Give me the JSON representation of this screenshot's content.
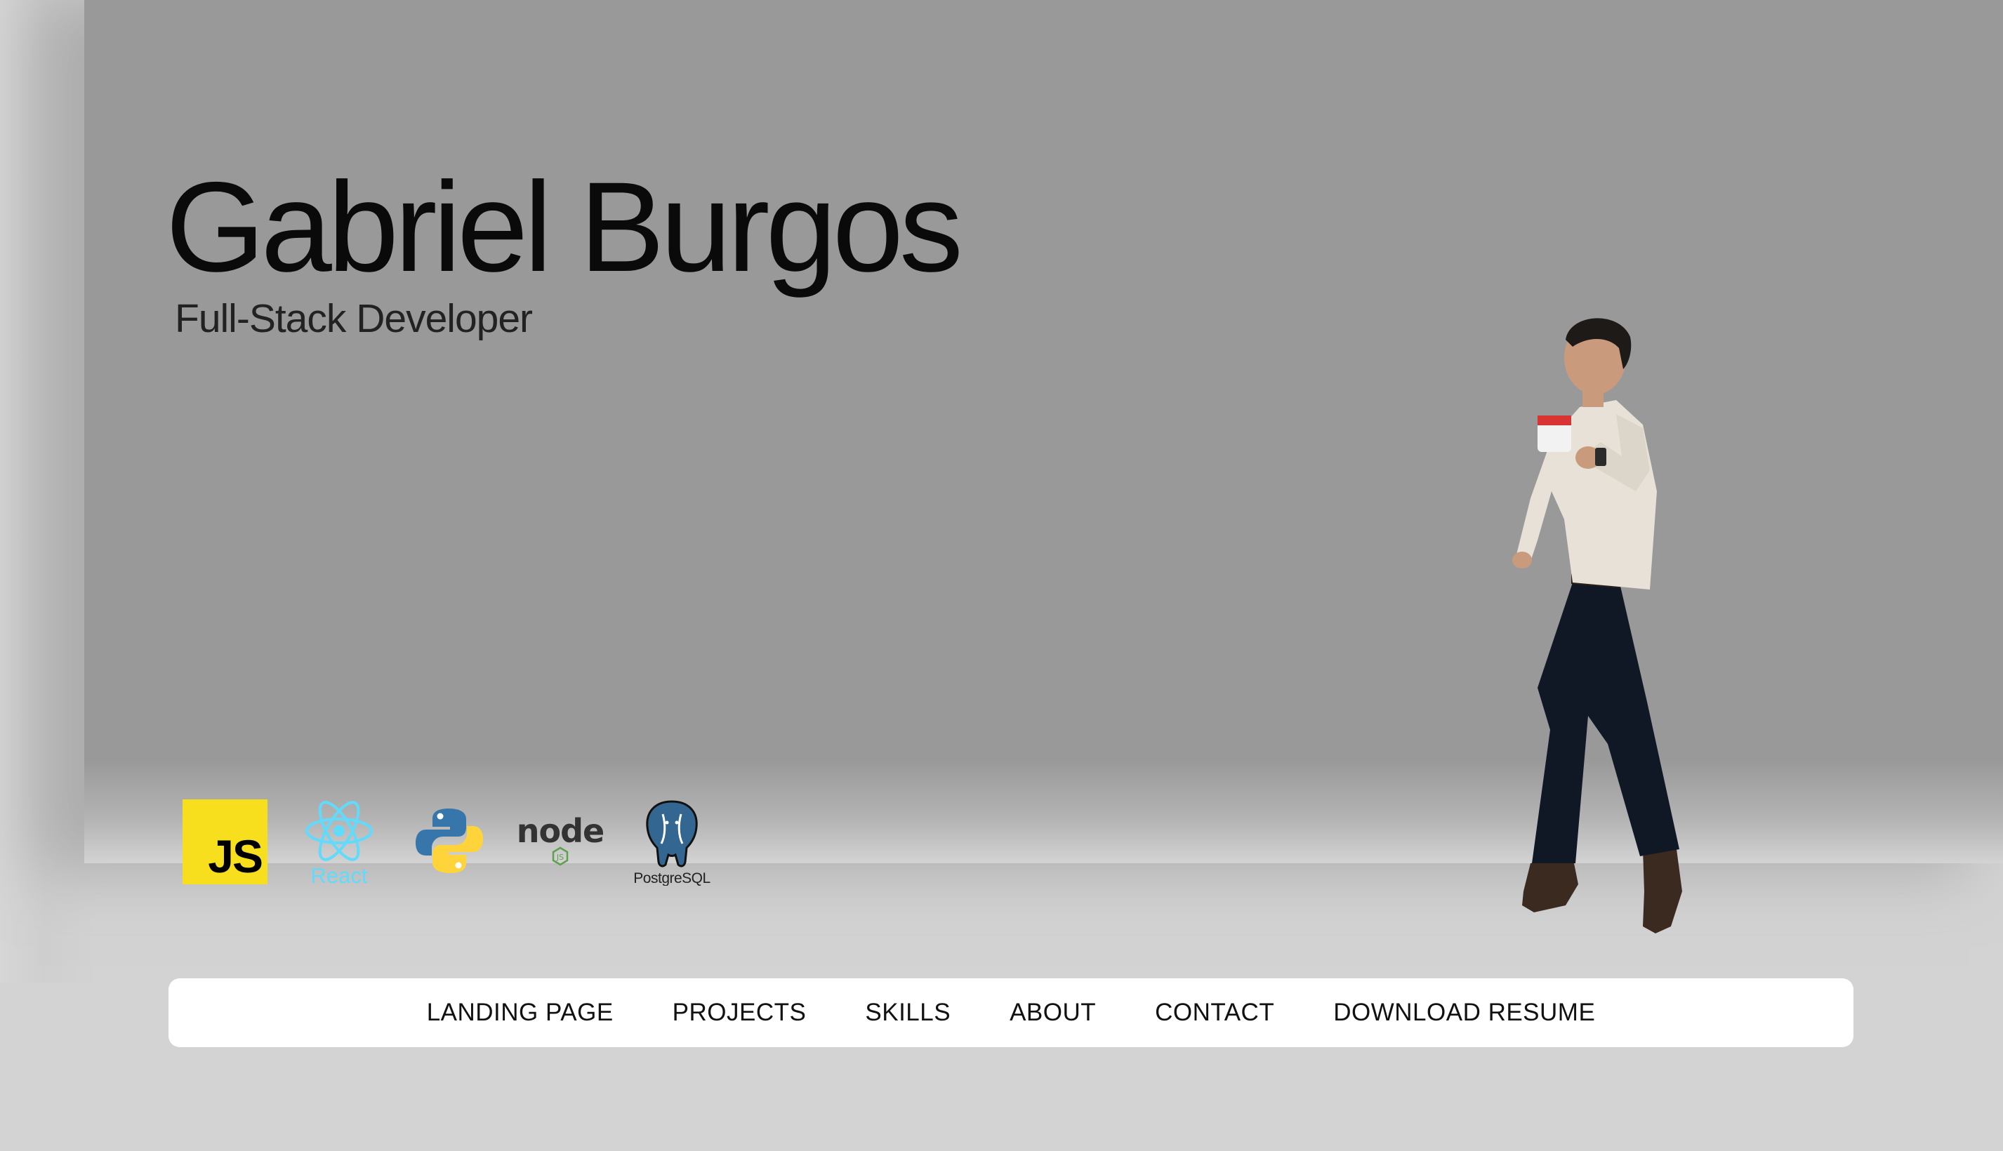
{
  "hero": {
    "name": "Gabriel Burgos",
    "role": "Full-Stack Developer"
  },
  "skills": [
    {
      "icon": "javascript-icon",
      "label": "JS",
      "color": "#f7df1e"
    },
    {
      "icon": "react-icon",
      "label": "React",
      "color": "#61dafb"
    },
    {
      "icon": "python-icon",
      "label": "",
      "colors": [
        "#3776ab",
        "#ffd43b"
      ]
    },
    {
      "icon": "nodejs-icon",
      "label": "node",
      "color": "#333333"
    },
    {
      "icon": "postgresql-icon",
      "label": "PostgreSQL",
      "color": "#336791"
    }
  ],
  "nav": {
    "items": [
      "LANDING PAGE",
      "PROJECTS",
      "SKILLS",
      "ABOUT",
      "CONTACT",
      "DOWNLOAD RESUME"
    ]
  },
  "colors": {
    "background": "#d3d3d3",
    "hero": "#999999",
    "nav_bg": "#ffffff",
    "text": "#0a0a0a"
  }
}
